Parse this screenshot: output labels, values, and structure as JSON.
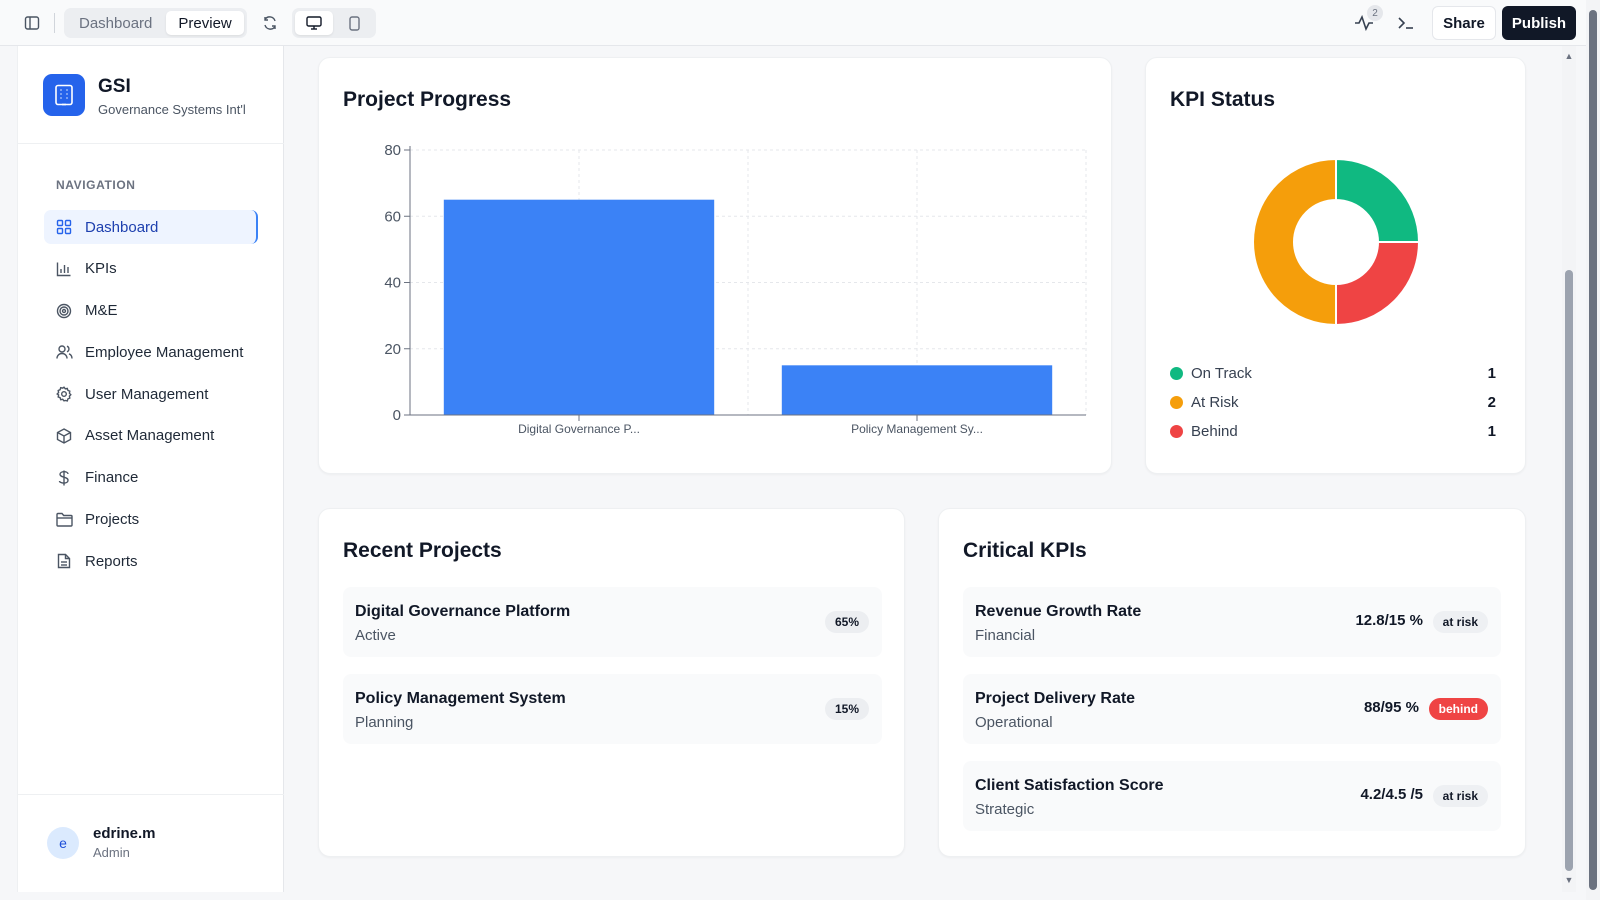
{
  "toolbar": {
    "tabs": [
      "Dashboard",
      "Preview"
    ],
    "active_tab": "Preview",
    "activity_count": "2",
    "share_label": "Share",
    "publish_label": "Publish"
  },
  "sidebar": {
    "brand_name": "GSI",
    "brand_subtitle": "Governance Systems Int'l",
    "nav_title": "NAVIGATION",
    "items": [
      {
        "label": "Dashboard",
        "icon": "grid-icon"
      },
      {
        "label": "KPIs",
        "icon": "bar-chart-icon"
      },
      {
        "label": "M&E",
        "icon": "target-icon"
      },
      {
        "label": "Employee Management",
        "icon": "users-icon"
      },
      {
        "label": "User Management",
        "icon": "gear-icon"
      },
      {
        "label": "Asset Management",
        "icon": "box-icon"
      },
      {
        "label": "Finance",
        "icon": "dollar-icon"
      },
      {
        "label": "Projects",
        "icon": "folder-icon"
      },
      {
        "label": "Reports",
        "icon": "document-icon"
      }
    ],
    "active_item": "Dashboard",
    "user": {
      "initial": "e",
      "name": "edrine.m",
      "role": "Admin"
    }
  },
  "project_progress": {
    "title": "Project Progress"
  },
  "kpi_status": {
    "title": "KPI Status",
    "legend": [
      {
        "label": "On Track",
        "count": "1",
        "color": "#10b981"
      },
      {
        "label": "At Risk",
        "count": "2",
        "color": "#f59e0b"
      },
      {
        "label": "Behind",
        "count": "1",
        "color": "#ef4444"
      }
    ]
  },
  "recent_projects": {
    "title": "Recent Projects",
    "items": [
      {
        "name": "Digital Governance Platform",
        "status": "Active",
        "progress": "65%"
      },
      {
        "name": "Policy Management System",
        "status": "Planning",
        "progress": "15%"
      }
    ]
  },
  "critical_kpis": {
    "title": "Critical KPIs",
    "items": [
      {
        "name": "Revenue Growth Rate",
        "category": "Financial",
        "value": "12.8/15 %",
        "status": "at risk"
      },
      {
        "name": "Project Delivery Rate",
        "category": "Operational",
        "value": "88/95 %",
        "status": "behind"
      },
      {
        "name": "Client Satisfaction Score",
        "category": "Strategic",
        "value": "4.2/4.5 /5",
        "status": "at risk"
      }
    ]
  },
  "colors": {
    "accent": "#3b82f6",
    "on_track": "#10b981",
    "at_risk": "#f59e0b",
    "behind": "#ef4444"
  },
  "chart_data": [
    {
      "type": "bar",
      "categories": [
        "Digital Governance P...",
        "Policy Management Sy..."
      ],
      "values": [
        65,
        15
      ],
      "ylim": [
        0,
        80
      ],
      "yticks": [
        "0",
        "20",
        "40",
        "60",
        "80"
      ],
      "grid": true,
      "color": "#3b82f6"
    },
    {
      "type": "pie",
      "donut": true,
      "labels": [
        "On Track",
        "Behind",
        "At Risk"
      ],
      "values": [
        1,
        1,
        2
      ],
      "colors": [
        "#10b981",
        "#ef4444",
        "#f59e0b"
      ]
    }
  ]
}
